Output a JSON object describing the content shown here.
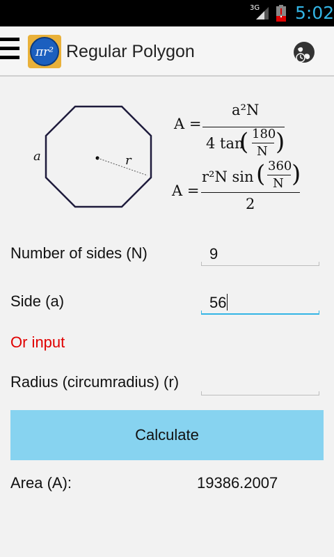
{
  "status_bar": {
    "network": "3G",
    "time": "5:02"
  },
  "action_bar": {
    "title": "Regular Polygon",
    "logo_text": "πr²",
    "icons": [
      "menu-icon",
      "app-logo-icon",
      "globe-icon"
    ]
  },
  "diagram": {
    "side_label": "a",
    "radius_label": "r",
    "sides": 8
  },
  "formulas": {
    "f1": {
      "lhs": "A =",
      "num": "a²N",
      "den_prefix": "4 tan",
      "inner_num": "180",
      "inner_den": "N"
    },
    "f2": {
      "lhs": "A =",
      "num_prefix": "r²N sin",
      "inner_num": "360",
      "inner_den": "N",
      "den": "2"
    }
  },
  "form": {
    "sides_label": "Number of sides (N)",
    "sides_value": "9",
    "side_label": "Side (a)",
    "side_value": "56",
    "or_input_label": "Or input",
    "radius_label": "Radius (circumradius) (r)",
    "radius_value": ""
  },
  "calculate_label": "Calculate",
  "result": {
    "label": "Area (A):",
    "value": "19386.2007"
  },
  "colors": {
    "accent": "#33b5e5",
    "button": "#87d3f0",
    "warning": "#e00000"
  }
}
